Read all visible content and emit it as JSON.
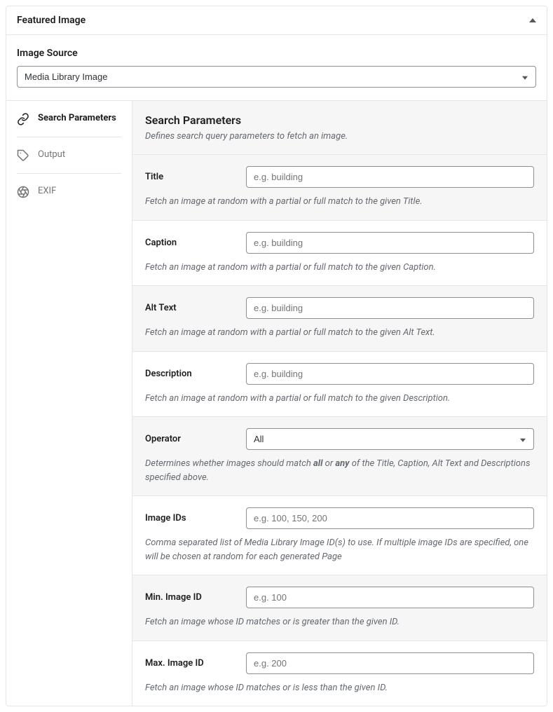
{
  "panel": {
    "title": "Featured Image"
  },
  "imageSource": {
    "label": "Image Source",
    "selected": "Media Library Image"
  },
  "tabs": {
    "searchParameters": "Search Parameters",
    "output": "Output",
    "exif": "EXIF"
  },
  "content": {
    "heading": "Search Parameters",
    "subheading": "Defines search query parameters to fetch an image."
  },
  "fields": {
    "title": {
      "label": "Title",
      "placeholder": "e.g. building",
      "help": "Fetch an image at random with a partial or full match to the given Title."
    },
    "caption": {
      "label": "Caption",
      "placeholder": "e.g. building",
      "help": "Fetch an image at random with a partial or full match to the given Caption."
    },
    "altText": {
      "label": "Alt Text",
      "placeholder": "e.g. building",
      "help": "Fetch an image at random with a partial or full match to the given Alt Text."
    },
    "description": {
      "label": "Description",
      "placeholder": "e.g. building",
      "help": "Fetch an image at random with a partial or full match to the given Description."
    },
    "operator": {
      "label": "Operator",
      "selected": "All",
      "help_pre": "Determines whether images should match ",
      "help_b1": "all",
      "help_mid": " or ",
      "help_b2": "any",
      "help_post": " of the Title, Caption, Alt Text and Descriptions specified above."
    },
    "imageIds": {
      "label": "Image IDs",
      "placeholder": "e.g. 100, 150, 200",
      "help": "Comma separated list of Media Library Image ID(s) to use. If multiple image IDs are specified, one will be chosen at random for each generated Page"
    },
    "minId": {
      "label": "Min. Image ID",
      "placeholder": "e.g. 100",
      "help": "Fetch an image whose ID matches or is greater than the given ID."
    },
    "maxId": {
      "label": "Max. Image ID",
      "placeholder": "e.g. 200",
      "help": "Fetch an image whose ID matches or is less than the given ID."
    }
  }
}
